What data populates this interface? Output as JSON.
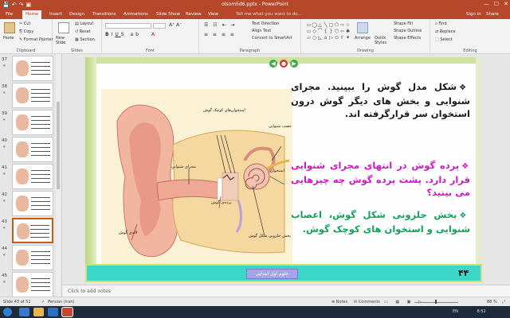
{
  "window": {
    "title": "olsom5d6.pptx - PowerPoint",
    "minimize": "—",
    "maximize": "☐",
    "close": "✕"
  },
  "tabs": [
    "File",
    "Home",
    "Insert",
    "Design",
    "Transitions",
    "Animations",
    "Slide Show",
    "Review",
    "View"
  ],
  "tellme": "Tell me what you want to do...",
  "signin": "Sign in",
  "share": "Share",
  "ribbon": {
    "paste": "Paste",
    "cut": "Cut",
    "copy": "Copy",
    "format_painter": "Format Painter",
    "new_slide": "New Slide",
    "layout": "Layout",
    "reset": "Reset",
    "section": "Section",
    "text_direction": "Text Direction",
    "align_text": "Align Text",
    "convert_smartart": "Convert to SmartArt",
    "arrange": "Arrange",
    "quick_styles": "Quick Styles",
    "shape_fill": "Shape Fill",
    "shape_outline": "Shape Outline",
    "shape_effects": "Shape Effects",
    "find": "Find",
    "replace": "Replace",
    "select": "Select",
    "groups": [
      "Clipboard",
      "Slides",
      "Font",
      "Paragraph",
      "Drawing",
      "Editing"
    ]
  },
  "thumbnails": [
    {
      "num": "37"
    },
    {
      "num": "38"
    },
    {
      "num": "39"
    },
    {
      "num": "40"
    },
    {
      "num": "41"
    },
    {
      "num": "42"
    },
    {
      "num": "43",
      "selected": true
    },
    {
      "num": "44"
    },
    {
      "num": "45"
    }
  ],
  "slide": {
    "para1": "شکل مدل گوش را ببینید. مجرای شنوایی و بخش های دیگر گوش درون استخوان سر قرارگرفته اند.",
    "para2": "پرده گوش در انتهای مجرای شنوایی قرار دارد. پشت پرده گوش چه چیزهایی می بینید؟",
    "para3": "بخش حلزونی شکل گوش، اعصاب شنوایی و استخوان های کوچک گوش.",
    "page_number": "۴۴",
    "footer_text": "علوم اول ابتدایی"
  },
  "diagram_labels": {
    "ossicles": "استخوان‌های کوچک گوش",
    "nerve": "عصب شنوایی",
    "bone": "استخوان",
    "canal": "مجرای شنوایی",
    "eardrum": "پرده‌ی گوش",
    "cochlea": "بخش حلزونی شکل گوش",
    "pinna": "لاله‌ی گوش"
  },
  "notes_placeholder": "Click to add notes",
  "status": {
    "slide_info": "Slide 43 of 51",
    "language": "Persian (Iran)",
    "notes": "Notes",
    "comments": "Comments",
    "zoom": "88 %"
  },
  "taskbar": {
    "lang": "EN",
    "time": "8:52"
  },
  "colors": {
    "accent": "#b7472a",
    "para1": "#1a1a1a",
    "para2": "#d414c4",
    "para3": "#14a05a",
    "footer": "#3bd6c5"
  }
}
